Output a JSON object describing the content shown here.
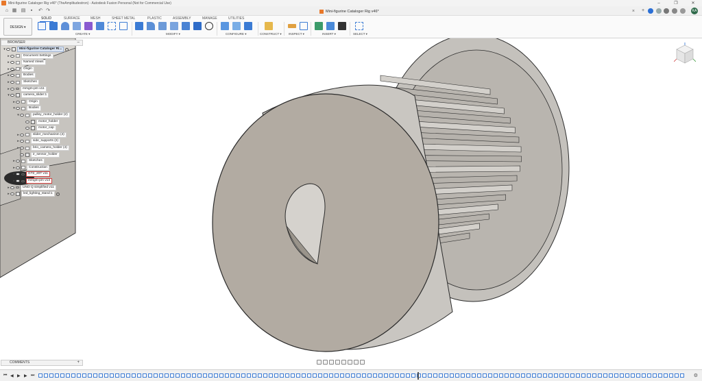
{
  "window": {
    "title": "Mini-figurine Cataloger Rig v46* (TheAmplitudestron) - Autodesk Fusion Personal (Not for Commercial Use)",
    "controls": [
      "–",
      "❐",
      "✕"
    ]
  },
  "document_tab": {
    "title": "Mini-figurine Cataloger Rig v46*",
    "close": "×"
  },
  "user": {
    "initials": "KA"
  },
  "toolbar": {
    "design_label": "DESIGN ▾",
    "workspace_tabs": [
      "SOLID",
      "SURFACE",
      "MESH",
      "SHEET METAL",
      "PLASTIC",
      "ASSEMBLY",
      "MANAGE",
      "UTILITIES"
    ],
    "active_tab": "SOLID",
    "groups": [
      "CREATE ▾",
      "MODIFY ▾",
      "CONFIGURE ▾",
      "CONSTRUCT ▾",
      "INSPECT ▾",
      "INSERT ▾",
      "SELECT ▾"
    ]
  },
  "browser": {
    "header": "BROWSER",
    "collapse": "–",
    "items": [
      {
        "label": "Mini-figurine Cataloger Ri...",
        "type": "root"
      },
      {
        "label": "Document Settings",
        "type": "settings"
      },
      {
        "label": "Named Views",
        "type": "folder"
      },
      {
        "label": "Origin",
        "type": "folder"
      },
      {
        "label": "Bodies",
        "type": "folder"
      },
      {
        "label": "Sketches",
        "type": "folder"
      },
      {
        "label": "mmgm-pm v11",
        "type": "link"
      },
      {
        "label": "camera_slider:1",
        "type": "comp"
      },
      {
        "label": "Origin",
        "type": "folder"
      },
      {
        "label": "Bodies",
        "type": "folder"
      },
      {
        "label": "pulley_motor_holder (2)",
        "type": "folder"
      },
      {
        "label": "motor_holder",
        "type": "body"
      },
      {
        "label": "motor_cap",
        "type": "body"
      },
      {
        "label": "slider_mechanism (4)",
        "type": "folder"
      },
      {
        "label": "side_supports (2)",
        "type": "folder"
      },
      {
        "label": "brio_camera_holder (4)",
        "type": "folder"
      },
      {
        "label": "ir_sensor_holder",
        "type": "body"
      },
      {
        "label": "Sketches",
        "type": "folder"
      },
      {
        "label": "Construction",
        "type": "folder"
      },
      {
        "label": "GT2_20T v11",
        "type": "link"
      },
      {
        "label": "mmgm-pm v13",
        "type": "link"
      },
      {
        "label": "UNO Q simplified v11",
        "type": "link"
      },
      {
        "label": "led_lighting_stand:1",
        "type": "comp"
      }
    ]
  },
  "comments": {
    "label": "COMMENTS",
    "plus": "+"
  },
  "colors": {
    "part": "#c9c6c1",
    "part_face": "#b3aca3",
    "edge": "#2b2b2b",
    "accent": "#2a6fd6",
    "select": "#d04040"
  }
}
